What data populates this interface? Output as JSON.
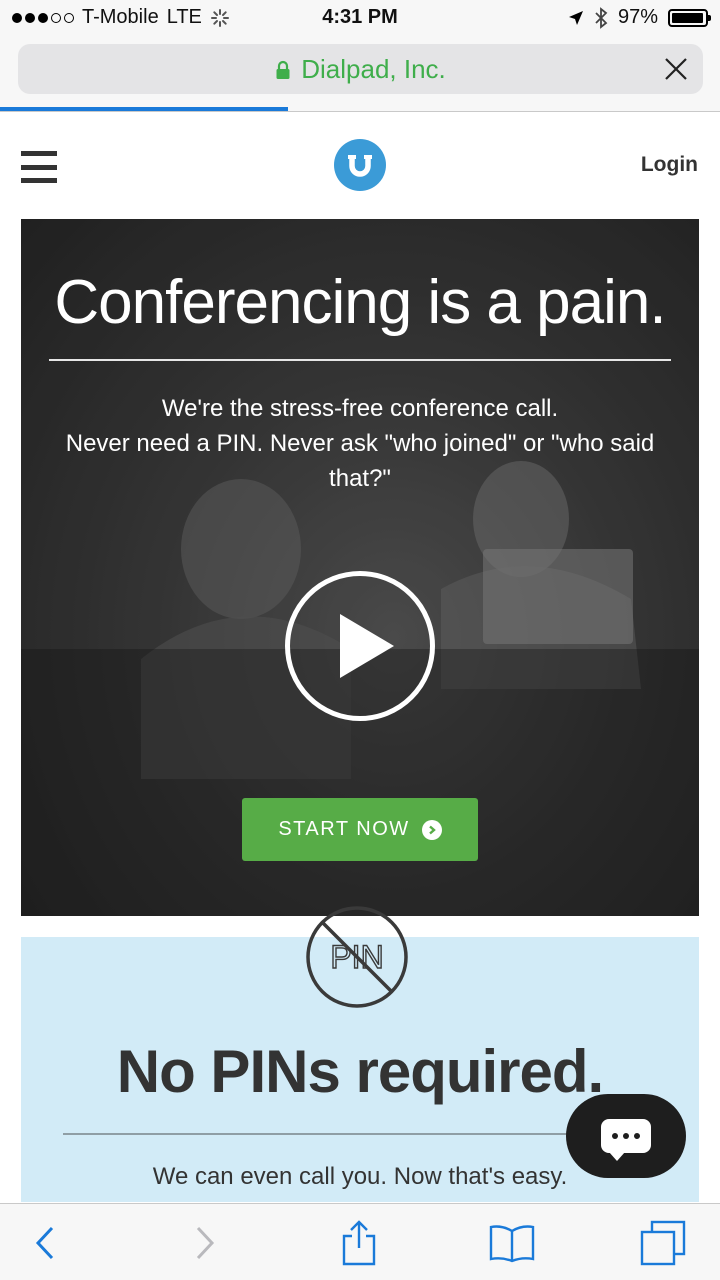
{
  "status_bar": {
    "carrier": "T-Mobile",
    "network": "LTE",
    "time": "4:31 PM",
    "battery_text": "97%",
    "battery_level": 0.97
  },
  "browser": {
    "url_label": "Dialpad, Inc.",
    "page_load_progress": 0.4
  },
  "header": {
    "login_label": "Login"
  },
  "hero": {
    "title": "Conferencing is a pain.",
    "subtitle_line1": "We're the stress-free conference call.",
    "subtitle_line2": "Never need a PIN. Never ask \"who joined\" or \"who said that?\"",
    "cta_label": "START NOW"
  },
  "pin_section": {
    "icon_text": "PIN",
    "title": "No PINs required.",
    "subtitle": "We can even call you. Now that's easy."
  },
  "colors": {
    "accent_green": "#57ac47",
    "url_green": "#3fae4b",
    "logo_blue": "#3b9bd7",
    "ios_blue": "#1a7ad9",
    "pin_bg": "#d2ebf7"
  }
}
